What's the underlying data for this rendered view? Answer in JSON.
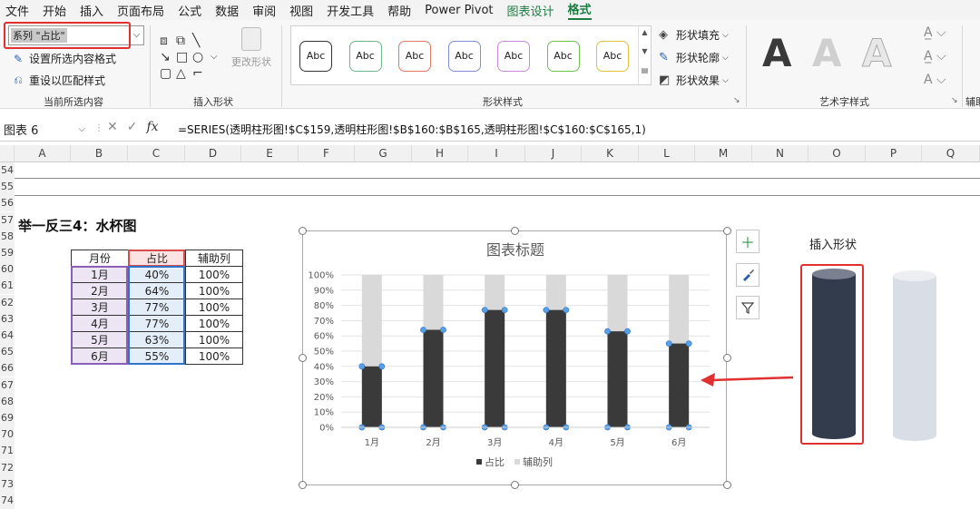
{
  "menu": [
    {
      "label": "文件"
    },
    {
      "label": "开始"
    },
    {
      "label": "插入"
    },
    {
      "label": "页面布局"
    },
    {
      "label": "公式"
    },
    {
      "label": "数据"
    },
    {
      "label": "审阅"
    },
    {
      "label": "视图"
    },
    {
      "label": "开发工具"
    },
    {
      "label": "帮助"
    },
    {
      "label": "Power Pivot"
    },
    {
      "label": "图表设计"
    },
    {
      "label": "格式"
    }
  ],
  "ribbon": {
    "current_selection": {
      "combo_value": "系列 \"占比\"",
      "format_selection": "设置所选内容格式",
      "reset_style": "重设以匹配样式",
      "group_label": "当前所选内容"
    },
    "insert_shapes": {
      "change_shape": "更改形状",
      "group_label": "插入形状"
    },
    "shape_styles": {
      "sample_label": "Abc",
      "swatches": [
        "#333333",
        "#6fb58a",
        "#e07a5f",
        "#7f8fd6",
        "#c98ad9",
        "#6fc24a",
        "#e0c040"
      ],
      "group_label": "形状样式"
    },
    "format_buttons": {
      "fill": "形状填充",
      "outline": "形状轮廓",
      "effects": "形状效果"
    },
    "wordart": {
      "letter": "A",
      "group_label": "艺术字样式"
    },
    "aux_label": "辅助"
  },
  "formula_bar": {
    "name_box": "图表 6",
    "cancel": "✕",
    "confirm": "✓",
    "fx": "fx",
    "formula": "=SERIES(透明柱形图!$C$159,透明柱形图!$B$160:$B$165,透明柱形图!$C$160:$C$165,1)"
  },
  "grid": {
    "columns": [
      "A",
      "B",
      "C",
      "D",
      "E",
      "F",
      "G",
      "H",
      "I",
      "J",
      "K",
      "L",
      "M",
      "N",
      "O",
      "P",
      "Q"
    ],
    "rows": [
      "54",
      "55",
      "56",
      "57",
      "58",
      "59",
      "60",
      "61",
      "62",
      "63",
      "64",
      "65",
      "66",
      "67",
      "68",
      "69",
      "70",
      "71",
      "72",
      "73",
      "74"
    ]
  },
  "section_title": "举一反三4：水杯图",
  "table": {
    "headers": [
      "月份",
      "占比",
      "辅助列"
    ],
    "rows": [
      [
        "1月",
        "40%",
        "100%"
      ],
      [
        "2月",
        "64%",
        "100%"
      ],
      [
        "3月",
        "77%",
        "100%"
      ],
      [
        "4月",
        "77%",
        "100%"
      ],
      [
        "5月",
        "63%",
        "100%"
      ],
      [
        "6月",
        "55%",
        "100%"
      ]
    ]
  },
  "chart_data": {
    "type": "bar",
    "title": "图表标题",
    "categories": [
      "1月",
      "2月",
      "3月",
      "4月",
      "5月",
      "6月"
    ],
    "series": [
      {
        "name": "占比",
        "values": [
          40,
          64,
          77,
          77,
          63,
          55
        ],
        "color": "#3a3a3a"
      },
      {
        "name": "辅助列",
        "values": [
          100,
          100,
          100,
          100,
          100,
          100
        ],
        "color": "#d9d9d9"
      }
    ],
    "ylim": [
      0,
      100
    ],
    "ytick_labels": [
      "0%",
      "10%",
      "20%",
      "30%",
      "40%",
      "50%",
      "60%",
      "70%",
      "80%",
      "90%",
      "100%"
    ],
    "grid": true,
    "legend": "bottom",
    "overlap": true
  },
  "side_panel": {
    "insert_shape_label": "插入形状",
    "cylinder_dark": "#333c4c",
    "cylinder_light": "#d9dde5"
  }
}
